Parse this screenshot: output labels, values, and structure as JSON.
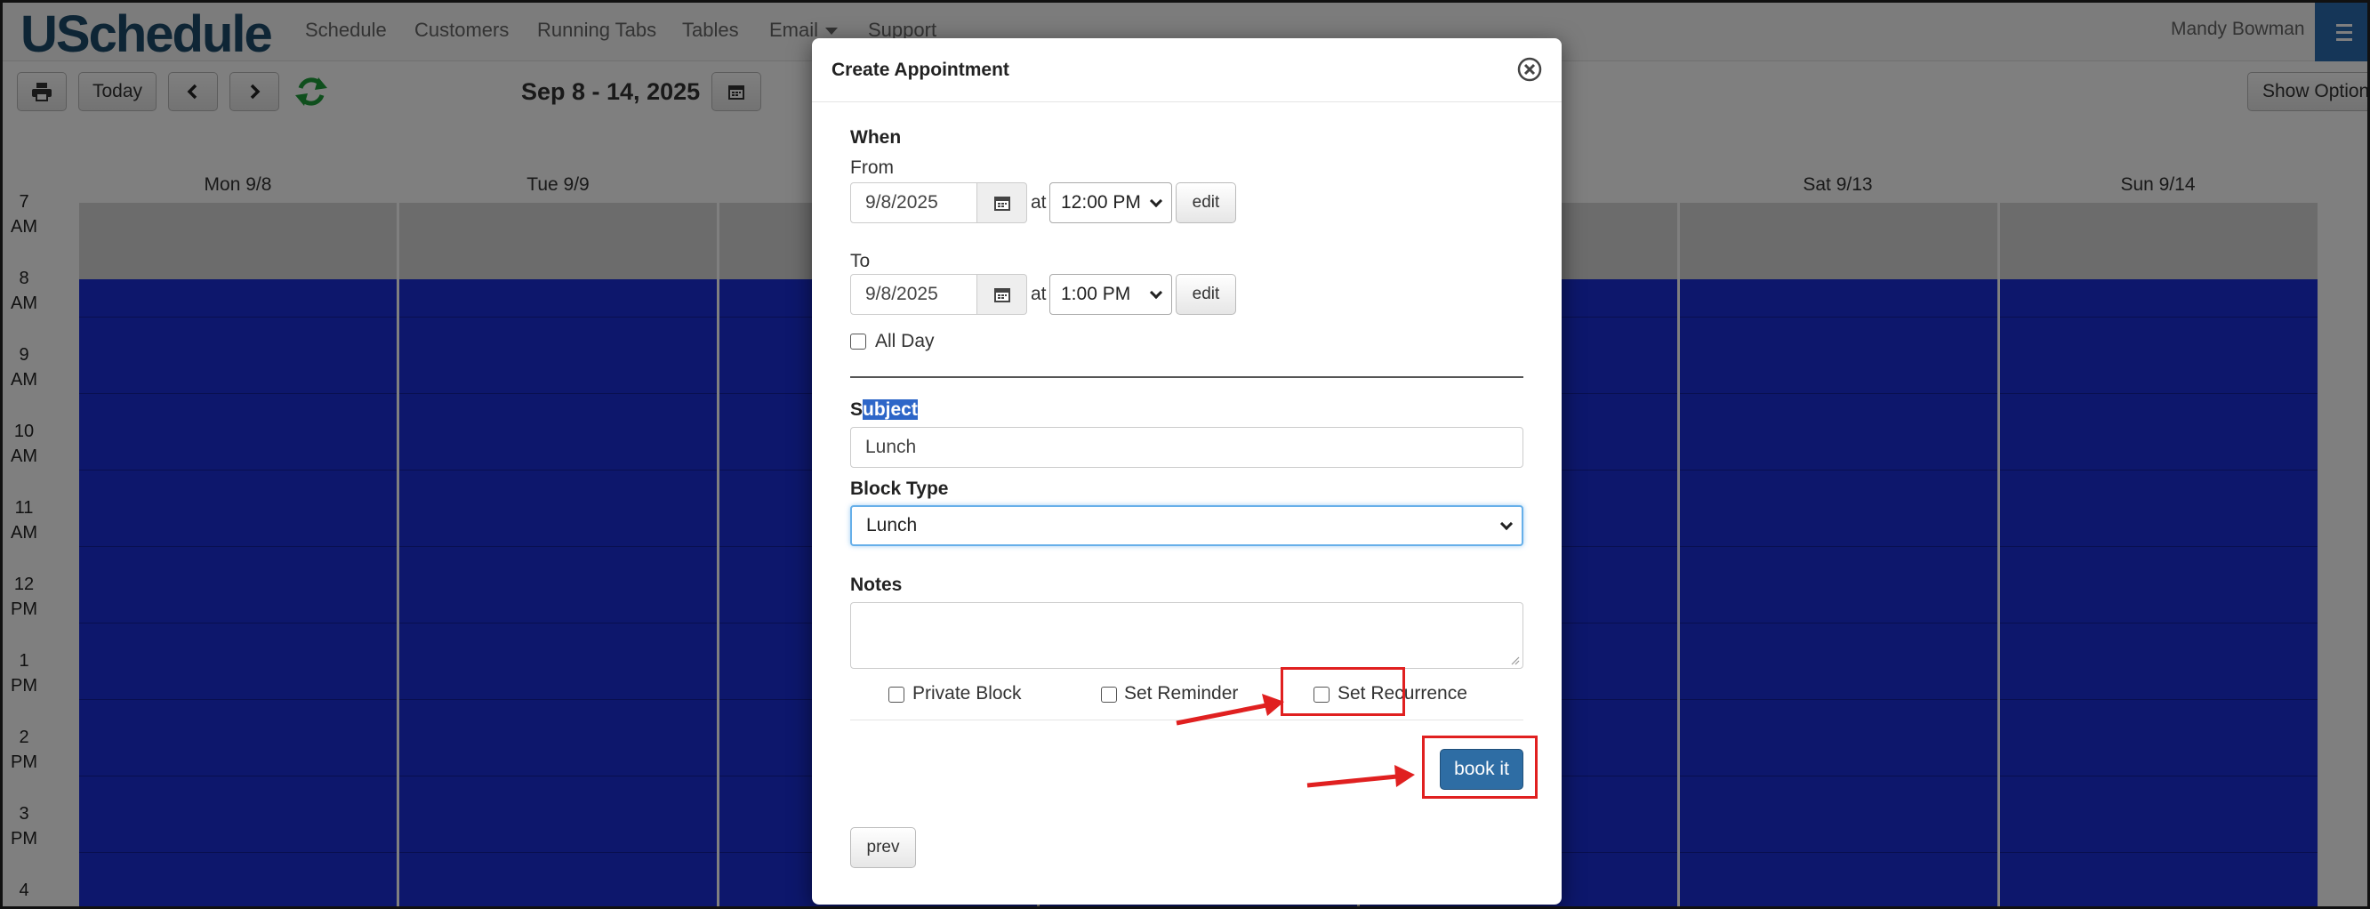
{
  "nav": {
    "logo": "USchedule",
    "items": [
      "Schedule",
      "Customers",
      "Running Tabs",
      "Tables",
      "Email",
      "Support"
    ],
    "user": "Mandy Bowman"
  },
  "toolbar": {
    "today_label": "Today",
    "date_range": "Sep 8 - 14, 2025",
    "show_options_label": "Show Options"
  },
  "calendar": {
    "days": [
      "Mon 9/8",
      "Tue 9/9",
      "",
      "",
      "",
      "Sat 9/13",
      "Sun 9/14"
    ],
    "hours": [
      {
        "num": "7",
        "ampm": "AM"
      },
      {
        "num": "8",
        "ampm": "AM"
      },
      {
        "num": "9",
        "ampm": "AM"
      },
      {
        "num": "10",
        "ampm": "AM"
      },
      {
        "num": "11",
        "ampm": "AM"
      },
      {
        "num": "12",
        "ampm": "PM"
      },
      {
        "num": "1",
        "ampm": "PM"
      },
      {
        "num": "2",
        "ampm": "PM"
      },
      {
        "num": "3",
        "ampm": "PM"
      },
      {
        "num": "4",
        "ampm": ""
      }
    ],
    "block_color": "#1b2fd8"
  },
  "modal": {
    "title": "Create Appointment",
    "when_label": "When",
    "from_label": "From",
    "from_date": "9/8/2025",
    "from_time": "12:00 PM",
    "to_label": "To",
    "to_date": "9/8/2025",
    "to_time": "1:00 PM",
    "at_label": "at",
    "edit_label": "edit",
    "all_day_label": "All Day",
    "subject_label_first": "S",
    "subject_label_rest": "ubject",
    "subject_value": "Lunch",
    "block_type_label": "Block Type",
    "block_type_value": "Lunch",
    "notes_label": "Notes",
    "private_block_label": "Private Block",
    "set_reminder_label": "Set Reminder",
    "set_recurrence_label": "Set Recurrence",
    "book_label": "book it",
    "prev_label": "prev"
  },
  "colors": {
    "accent": "#2e6da4",
    "annotation": "#e02020"
  }
}
